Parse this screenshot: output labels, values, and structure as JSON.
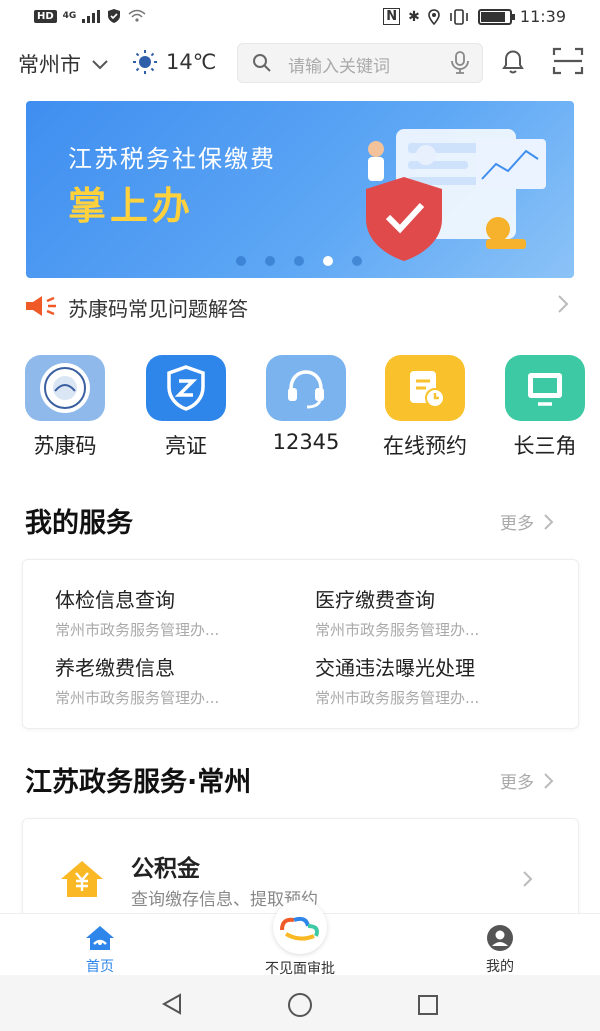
{
  "status_bar": {
    "network_left": "HD",
    "signal_label": "4G",
    "time": "11:39"
  },
  "header": {
    "city": "常州市",
    "temperature": "14℃",
    "search_placeholder": "请输入关键词"
  },
  "banner": {
    "line1": "江苏税务社保缴费",
    "line2": "掌上办",
    "slide_count": 5,
    "active_slide": 4
  },
  "notice": {
    "text": "苏康码常见问题解答"
  },
  "quick_actions": [
    {
      "label": "苏康码",
      "icon": "emblem-icon",
      "color": "#8fb9ea"
    },
    {
      "label": "亮证",
      "icon": "shield-z-icon",
      "color": "#2f86ea"
    },
    {
      "label": "12345",
      "icon": "headset-icon",
      "color": "#7ab3ee"
    },
    {
      "label": "在线预约",
      "icon": "calendar-clock-icon",
      "color": "#f9c22c"
    },
    {
      "label": "长三角",
      "icon": "monitor-icon",
      "color": "#3dc9a3"
    }
  ],
  "my_services": {
    "title": "我的服务",
    "more": "更多",
    "items": [
      {
        "name": "体检信息查询",
        "sub": "常州市政务服务管理办..."
      },
      {
        "name": "医疗缴费查询",
        "sub": "常州市政务服务管理办..."
      },
      {
        "name": "养老缴费信息",
        "sub": "常州市政务服务管理办..."
      },
      {
        "name": "交通违法曝光处理",
        "sub": "常州市政务服务管理办..."
      }
    ]
  },
  "gov_services": {
    "title": "江苏政务服务·常州",
    "more": "更多",
    "card": {
      "name": "公积金",
      "sub": "查询缴存信息、提取预约",
      "icon": "house-yuan-icon"
    }
  },
  "tabbar": [
    {
      "label": "首页",
      "active": true,
      "icon": "home-icon"
    },
    {
      "label": "不见面审批",
      "active": false,
      "icon": "approval-logo-icon"
    },
    {
      "label": "我的",
      "active": false,
      "icon": "profile-icon"
    }
  ],
  "colors": {
    "accent": "#2f86ea",
    "banner_highlight": "#ffd23d",
    "notice_icon": "#f05a28"
  }
}
